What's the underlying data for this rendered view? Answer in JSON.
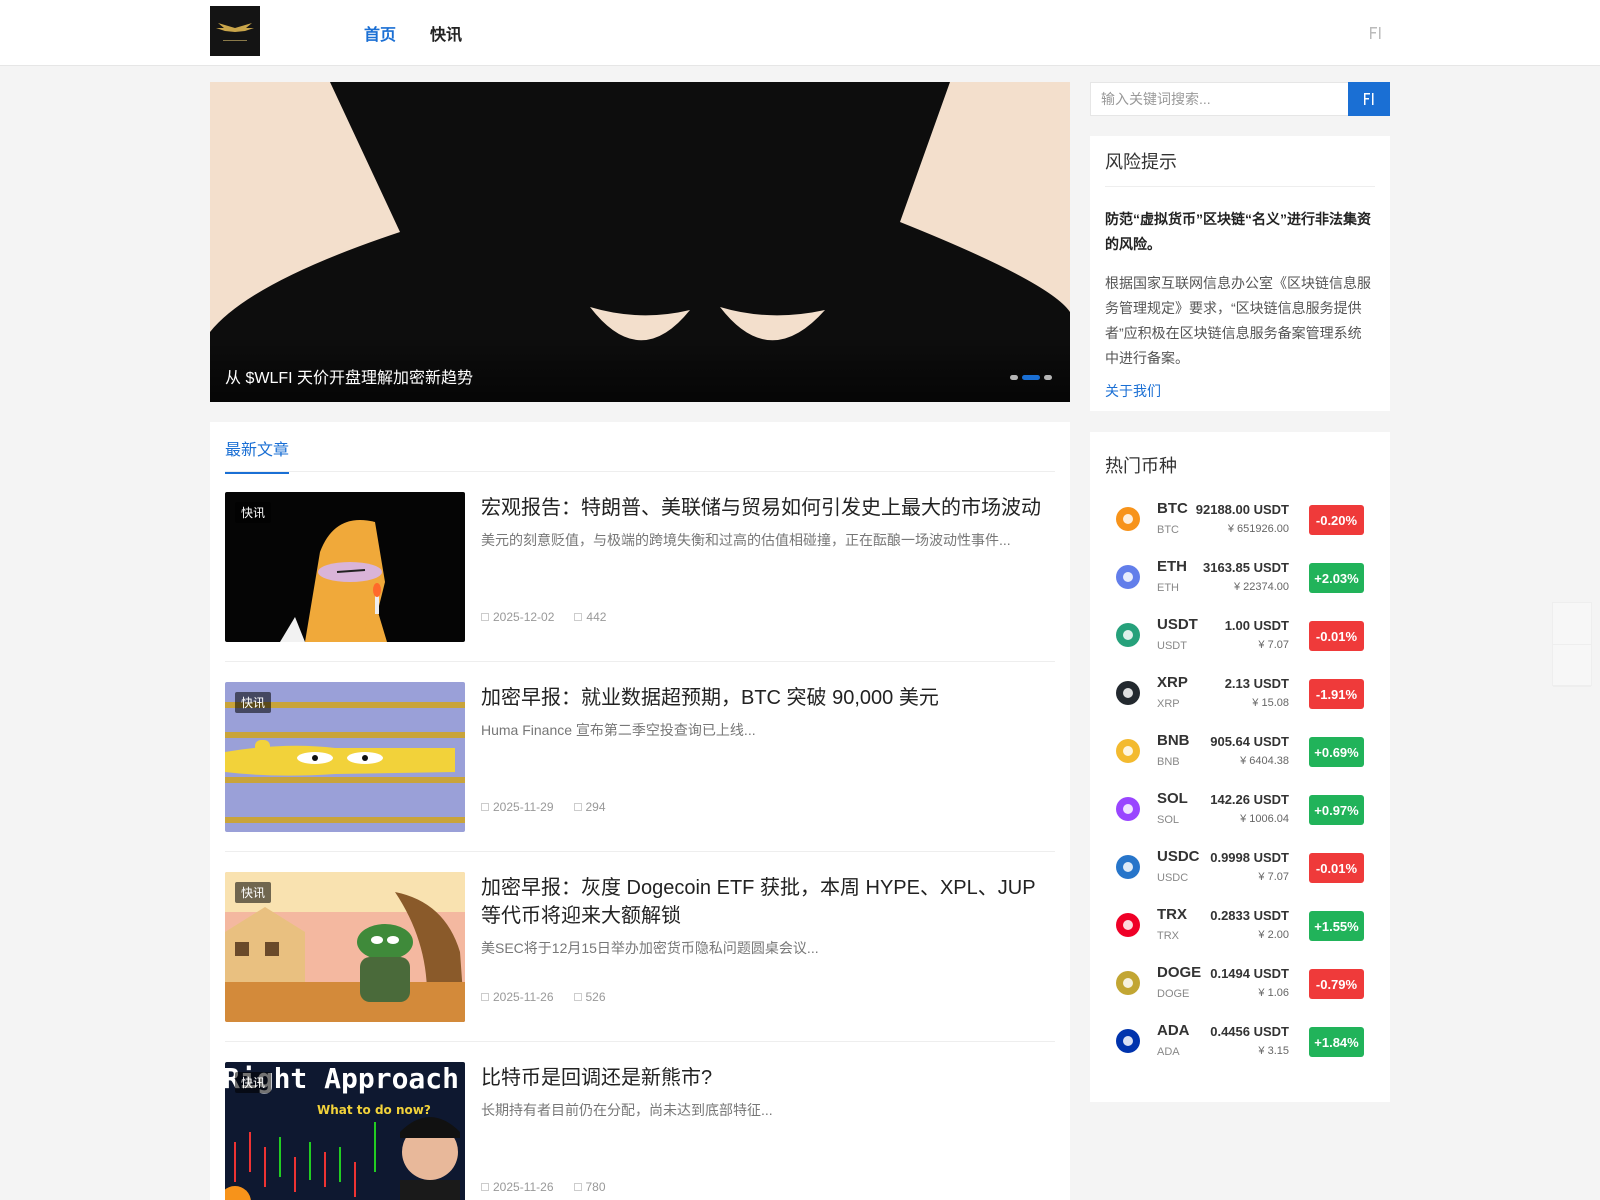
{
  "header": {
    "nav": [
      {
        "label": "首页",
        "active": true
      },
      {
        "label": "快讯",
        "active": false
      }
    ]
  },
  "slider": {
    "caption": "从 $WLFI 天价开盘理解加密新趋势",
    "slides": 3,
    "active_slide": 2
  },
  "main": {
    "tab_label": "最新文章",
    "articles": [
      {
        "tag": "快讯",
        "title": "宏观报告：特朗普、美联储与贸易如何引发史上最大的市场波动",
        "excerpt": "美元的刻意贬值，与极端的跨境失衡和过高的估值相碰撞，正在酝酿一场波动性事件...",
        "date": "2025-12-02",
        "views": "442"
      },
      {
        "tag": "快讯",
        "title": "加密早报：就业数据超预期，BTC 突破 90,000 美元",
        "excerpt": "Huma Finance 宣布第二季空投查询已上线...",
        "date": "2025-11-29",
        "views": "294"
      },
      {
        "tag": "快讯",
        "title": "加密早报：灰度 Dogecoin ETF 获批，本周 HYPE、XPL、JUP 等代币将迎来大额解锁",
        "excerpt": "美SEC将于12月15日举办加密货币隐私问题圆桌会议...",
        "date": "2025-11-26",
        "views": "526"
      },
      {
        "tag": "快讯",
        "title": "比特币是回调还是新熊市?",
        "excerpt": "长期持有者目前仍在分配，尚未达到底部特征...",
        "date": "2025-11-26",
        "views": "780",
        "thumb_text": "Right Approach",
        "thumb_sub": "What to do now?"
      }
    ]
  },
  "sidebar": {
    "search_placeholder": "输入关键词搜索...",
    "risk": {
      "title": "风险提示",
      "headline": "防范“虚拟货币”区块链“名义”进行非法集资的风险。",
      "body": "根据国家互联网信息办公室《区块链信息服务管理规定》要求，“区块链信息服务提供者”应积极在区块链信息服务备案管理系统中进行备案。",
      "link": "关于我们"
    },
    "coins_title": "热门币种",
    "coins": [
      {
        "symbol": "BTC",
        "name": "BTC",
        "price": "92188.00 USDT",
        "cny": "¥ 651926.00",
        "change": "-0.20%",
        "dir": "down",
        "color": "#f7931a",
        "icon": "btc-icon"
      },
      {
        "symbol": "ETH",
        "name": "ETH",
        "price": "3163.85 USDT",
        "cny": "¥ 22374.00",
        "change": "+2.03%",
        "dir": "up",
        "color": "#627eea",
        "icon": "eth-icon"
      },
      {
        "symbol": "USDT",
        "name": "USDT",
        "price": "1.00 USDT",
        "cny": "¥ 7.07",
        "change": "-0.01%",
        "dir": "down",
        "color": "#26a17b",
        "icon": "usdt-icon"
      },
      {
        "symbol": "XRP",
        "name": "XRP",
        "price": "2.13 USDT",
        "cny": "¥ 15.08",
        "change": "-1.91%",
        "dir": "down",
        "color": "#23292f",
        "icon": "xrp-icon"
      },
      {
        "symbol": "BNB",
        "name": "BNB",
        "price": "905.64 USDT",
        "cny": "¥ 6404.38",
        "change": "+0.69%",
        "dir": "up",
        "color": "#f3ba2f",
        "icon": "bnb-icon"
      },
      {
        "symbol": "SOL",
        "name": "SOL",
        "price": "142.26 USDT",
        "cny": "¥ 1006.04",
        "change": "+0.97%",
        "dir": "up",
        "color": "#9945ff",
        "icon": "sol-icon"
      },
      {
        "symbol": "USDC",
        "name": "USDC",
        "price": "0.9998 USDT",
        "cny": "¥ 7.07",
        "change": "-0.01%",
        "dir": "down",
        "color": "#2775ca",
        "icon": "usdc-icon"
      },
      {
        "symbol": "TRX",
        "name": "TRX",
        "price": "0.2833 USDT",
        "cny": "¥ 2.00",
        "change": "+1.55%",
        "dir": "up",
        "color": "#ef0027",
        "icon": "trx-icon"
      },
      {
        "symbol": "DOGE",
        "name": "DOGE",
        "price": "0.1494 USDT",
        "cny": "¥ 1.06",
        "change": "-0.79%",
        "dir": "down",
        "color": "#c2a633",
        "icon": "doge-icon"
      },
      {
        "symbol": "ADA",
        "name": "ADA",
        "price": "0.4456 USDT",
        "cny": "¥ 3.15",
        "change": "+1.84%",
        "dir": "up",
        "color": "#0033ad",
        "icon": "ada-icon"
      }
    ]
  }
}
